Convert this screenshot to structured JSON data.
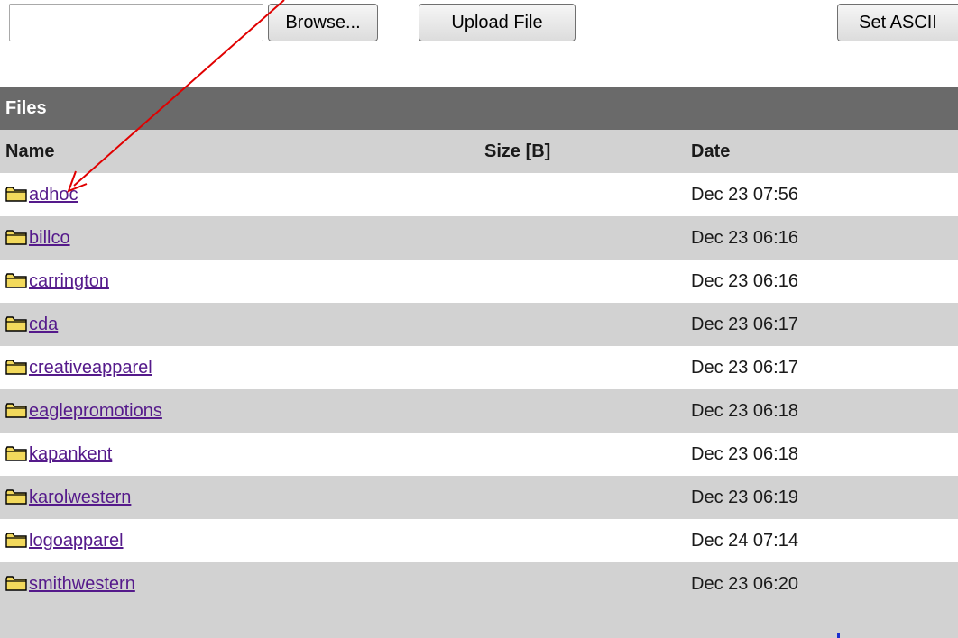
{
  "toolbar": {
    "file_input_value": "",
    "browse_label": "Browse...",
    "upload_label": "Upload File",
    "ascii_label": "Set ASCII"
  },
  "files": {
    "section_title": "Files",
    "columns": {
      "name": "Name",
      "size": "Size [B]",
      "date": "Date"
    },
    "rows": [
      {
        "name": "adhoc",
        "size": "",
        "date": "Dec 23 07:56",
        "icon": "folder-icon"
      },
      {
        "name": "billco",
        "size": "",
        "date": "Dec 23 06:16",
        "icon": "folder-icon"
      },
      {
        "name": "carrington",
        "size": "",
        "date": "Dec 23 06:16",
        "icon": "folder-icon"
      },
      {
        "name": "cda",
        "size": "",
        "date": "Dec 23 06:17",
        "icon": "folder-icon"
      },
      {
        "name": "creativeapparel",
        "size": "",
        "date": "Dec 23 06:17",
        "icon": "folder-icon"
      },
      {
        "name": "eaglepromotions",
        "size": "",
        "date": "Dec 23 06:18",
        "icon": "folder-icon"
      },
      {
        "name": "kapankent",
        "size": "",
        "date": "Dec 23 06:18",
        "icon": "folder-icon"
      },
      {
        "name": "karolwestern",
        "size": "",
        "date": "Dec 23 06:19",
        "icon": "folder-icon"
      },
      {
        "name": "logoapparel",
        "size": "",
        "date": "Dec 24 07:14",
        "icon": "folder-icon"
      },
      {
        "name": "smithwestern",
        "size": "",
        "date": "Dec 23 06:20",
        "icon": "folder-icon"
      }
    ]
  },
  "colors": {
    "header_bg": "#6a6a6a",
    "row_alt_bg": "#d2d2d2",
    "link": "#551a8b",
    "annotation_arrow": "#e00000"
  }
}
